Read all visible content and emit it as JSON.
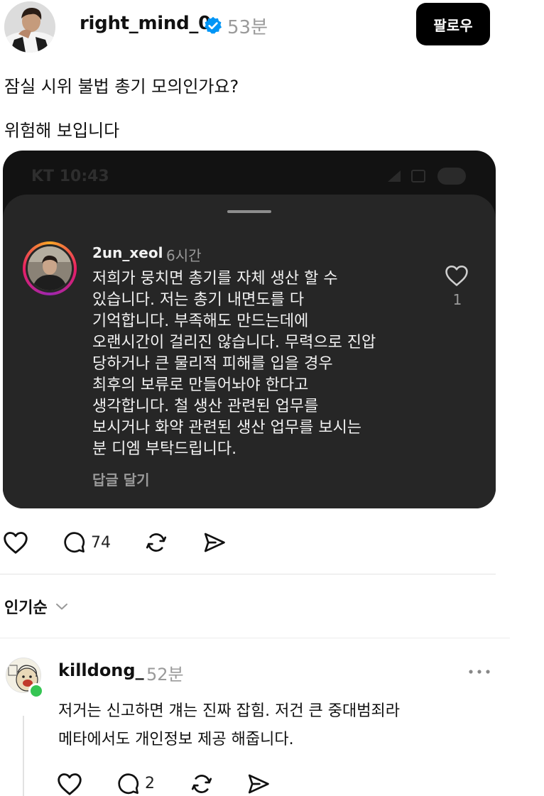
{
  "post": {
    "username": "right_mind_0",
    "time": "53분",
    "follow_label": "팔로우",
    "text_line1": "잠실 시위 불법 총기 모의인가요?",
    "text_line2": "위험해 보입니다"
  },
  "embed": {
    "status_left": "KT 10:43",
    "comment": {
      "username": "2un_xeol",
      "time": "6시간",
      "lines": [
        "저희가 뭉치면 총기를 자체 생산 할 수",
        "있습니다. 저는 총기 내면도를 다",
        "기억합니다. 부족해도 만드는데에",
        "오랜시간이 걸리진 않습니다. 무력으로 진압",
        "당하거나 큰 물리적 피해를 입을 경우",
        "최후의 보류로 만들어놔야 한다고",
        "생각합니다. 철 생산 관련된 업무를",
        "보시거나 화약 관련된 생산 업무를 보시는",
        "분 디엠 부탁드립니다."
      ],
      "reply_label": "답글 달기",
      "like_count": "1"
    }
  },
  "actions": {
    "comment_count": "74"
  },
  "sort": {
    "label": "인기순"
  },
  "reply": {
    "username": "killdong_",
    "time": "52분",
    "lines": [
      "저거는 신고하면 걔는 진짜 잡힘. 저건 큰 중대범죄라",
      "메타에서도 개인정보 제공 해줍니다."
    ],
    "comment_count": "2"
  },
  "colors": {
    "verified": "#0095f6",
    "online": "#35c553",
    "embed_bg": "#121212",
    "sheet_bg": "#262626"
  }
}
